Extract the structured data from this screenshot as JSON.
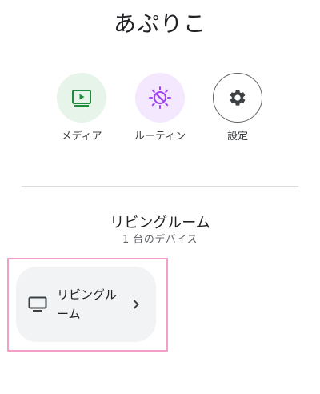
{
  "app": {
    "title": "あぷりこ"
  },
  "quick_actions": [
    {
      "label": "メディア",
      "icon": "media-play-icon",
      "bg": "#e6f4ea",
      "fg": "#1e8e3e"
    },
    {
      "label": "ルーティン",
      "icon": "routine-sun-icon",
      "bg": "#f3e8fd",
      "fg": "#a142f4"
    },
    {
      "label": "設定",
      "icon": "gear-icon",
      "bg": "#ffffff",
      "fg": "#3c4043"
    }
  ],
  "room": {
    "name": "リビングルーム",
    "device_count": "1 台のデバイス"
  },
  "device": {
    "label": "リビングルーム",
    "icon": "tv-icon"
  },
  "colors": {
    "highlight_border": "#f2a0c9",
    "card_bg": "#f1f3f4"
  }
}
